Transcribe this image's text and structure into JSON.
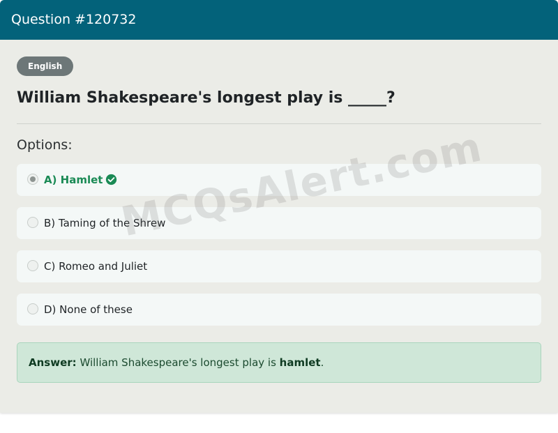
{
  "header": {
    "title": "Question #120732"
  },
  "badge": {
    "label": "English"
  },
  "question": {
    "text": "William Shakespeare's longest play is _____?"
  },
  "options_heading": "Options:",
  "options": [
    {
      "label": "A) Hamlet",
      "selected": true,
      "correct": true
    },
    {
      "label": "B) Taming of the Shrew",
      "selected": false,
      "correct": false
    },
    {
      "label": "C) Romeo and Juliet",
      "selected": false,
      "correct": false
    },
    {
      "label": "D) None of these",
      "selected": false,
      "correct": false
    }
  ],
  "answer": {
    "prefix": "Answer:",
    "text": "William Shakespeare's longest play is",
    "value": "hamlet",
    "suffix": "."
  },
  "watermark": "MCQsAlert.com",
  "colors": {
    "header": "#03627a",
    "badge": "#6d7778",
    "correct": "#1a8a55",
    "answer_bg": "#cfe7d8"
  }
}
